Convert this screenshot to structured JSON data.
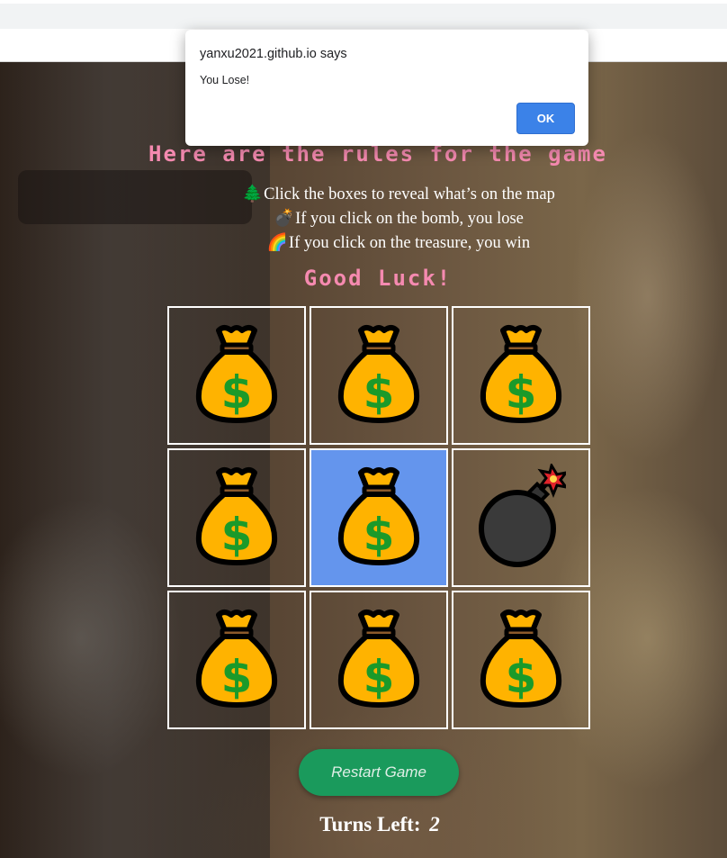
{
  "dialog": {
    "origin": "yanxu2021.github.io says",
    "message": "You Lose!",
    "ok_label": "OK"
  },
  "rules": {
    "title": "Here are the rules for the game",
    "lines": [
      {
        "icon": "tree-icon",
        "glyph": "🌲",
        "text": "Click the boxes to reveal what’s on the map"
      },
      {
        "icon": "bomb-icon",
        "glyph": "💣",
        "text": "If you click on the bomb, you lose"
      },
      {
        "icon": "rainbow-icon",
        "glyph": "🌈",
        "text": "If you click on the treasure, you win"
      }
    ],
    "good_luck": "Good Luck!"
  },
  "board": {
    "cells": [
      {
        "content": "money-bag-icon",
        "selected": false
      },
      {
        "content": "money-bag-icon",
        "selected": false
      },
      {
        "content": "money-bag-icon",
        "selected": false
      },
      {
        "content": "money-bag-icon",
        "selected": false
      },
      {
        "content": "money-bag-icon",
        "selected": true
      },
      {
        "content": "bomb-icon",
        "selected": false
      },
      {
        "content": "money-bag-icon",
        "selected": false
      },
      {
        "content": "money-bag-icon",
        "selected": false
      },
      {
        "content": "money-bag-icon",
        "selected": false
      }
    ],
    "selected_color": "#6495ed"
  },
  "restart_label": "Restart Game",
  "turns": {
    "label": "Turns Left:",
    "value": "2"
  },
  "colors": {
    "title_pink": "#f58ab0",
    "restart_green": "#1a9a5c",
    "ok_blue": "#3b82e8"
  }
}
